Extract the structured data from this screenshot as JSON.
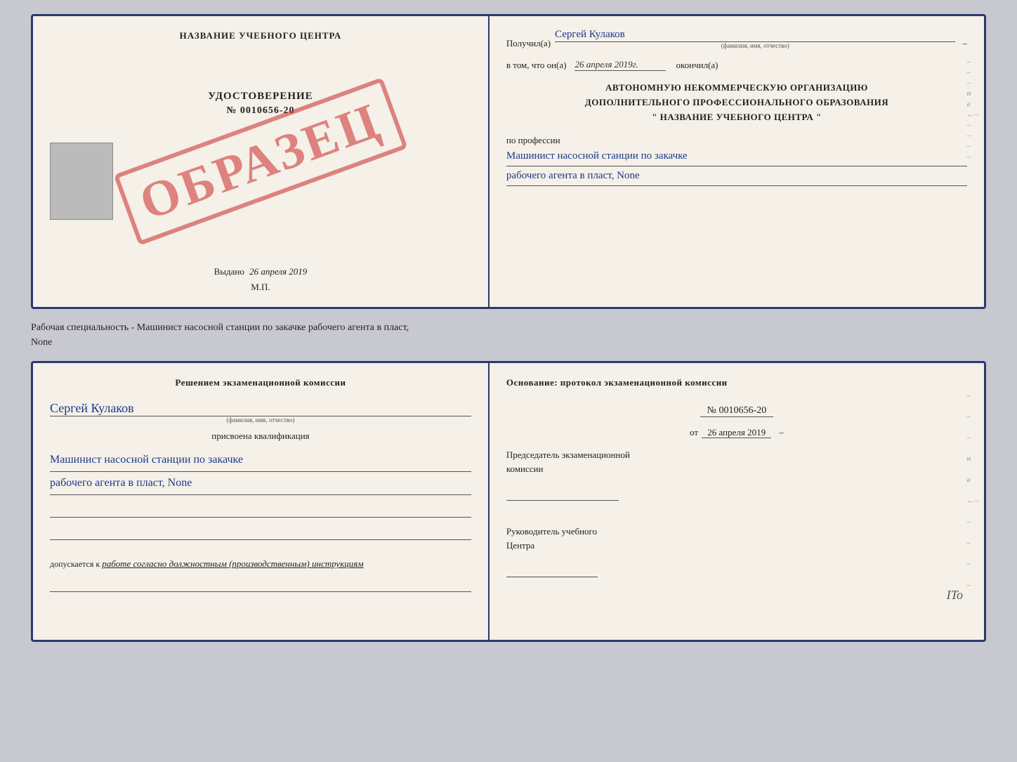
{
  "doc_top": {
    "left": {
      "center_title": "НАЗВАНИЕ УЧЕБНОГО ЦЕНТРА",
      "stamp": "ОБРАЗЕЦ",
      "udostoverenie": "УДОСТОВЕРЕНИЕ",
      "number": "№ 0010656-20",
      "vydano_label": "Выдано",
      "vydano_date": "26 апреля 2019",
      "mp_label": "М.П."
    },
    "right": {
      "poluchil_label": "Получил(а)",
      "poluchil_value": "Сергей Кулаков",
      "poluchil_subtext": "(фамилия, имя, отчество)",
      "vtom_label": "в том, что он(а)",
      "vtom_date": "26 апреля 2019г.",
      "okonchil_label": "окончил(а)",
      "block_line1": "АВТОНОМНУЮ НЕКОММЕРЧЕСКУЮ ОРГАНИЗАЦИЮ",
      "block_line2": "ДОПОЛНИТЕЛЬНОГО ПРОФЕССИОНАЛЬНОГО ОБРАЗОВАНИЯ",
      "block_line3": "\"  НАЗВАНИЕ УЧЕБНОГО ЦЕНТРА  \"",
      "po_professii": "по профессии",
      "profession_line1": "Машинист насосной станции по закачке",
      "profession_line2": "рабочего агента в пласт, None",
      "dashes": [
        "-",
        "-",
        "-",
        "и",
        "а",
        "←",
        "-",
        "-",
        "-",
        "-"
      ]
    }
  },
  "separator": {
    "text": "Рабочая специальность - Машинист насосной станции по закачке рабочего агента в пласт,",
    "text2": "None"
  },
  "doc_bottom": {
    "left": {
      "title": "Решением экзаменационной комиссии",
      "name_value": "Сергей Кулаков",
      "name_subtext": "(фамилия, имя, отчество)",
      "prisvoena": "присвоена квалификация",
      "profession_line1": "Машинист насосной станции по закачке",
      "profession_line2": "рабочего агента в пласт, None",
      "dopuskaetsya_label": "допускается к",
      "dopuskaetsya_value": "работе согласно должностным (производственным) инструкциям"
    },
    "right": {
      "osnov_title": "Основание: протокол экзаменационной комиссии",
      "protocol_number": "№ 0010656-20",
      "protocol_date_prefix": "от",
      "protocol_date": "26 апреля 2019",
      "predsedatel_line1": "Председатель экзаменационной",
      "predsedatel_line2": "комиссии",
      "rukovoditel_line1": "Руководитель учебного",
      "rukovoditel_line2": "Центра",
      "dashes_right": [
        "-",
        "-",
        "-",
        "и",
        "а",
        "←",
        "-",
        "-",
        "-",
        "-"
      ],
      "ito": "ITo"
    }
  }
}
